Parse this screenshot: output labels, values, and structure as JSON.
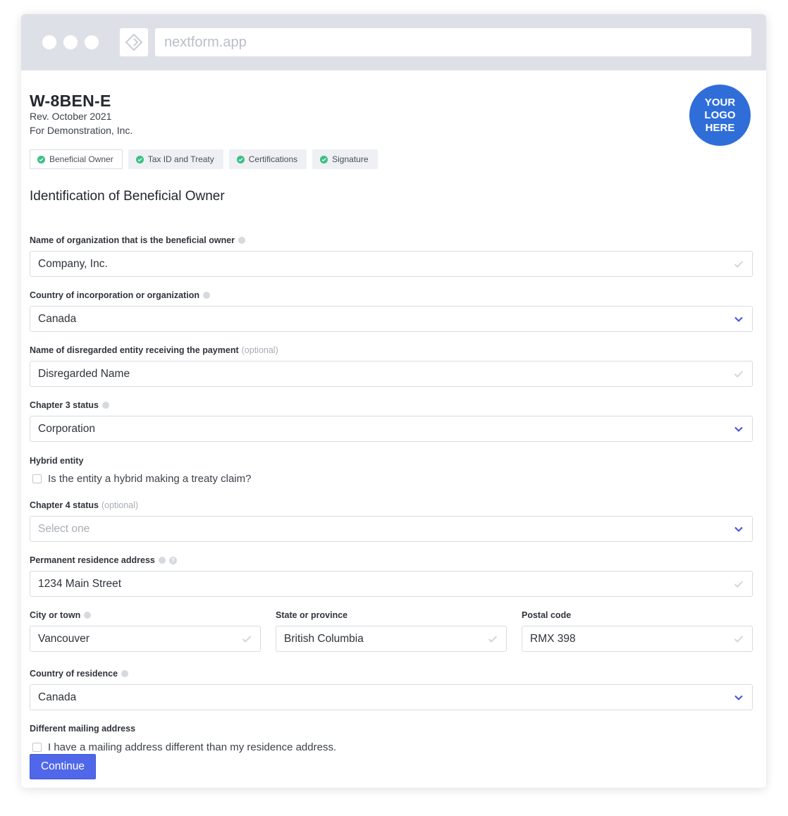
{
  "browser": {
    "url": "nextform.app"
  },
  "header": {
    "form_title": "W-8BEN-E",
    "revision": "Rev. October 2021",
    "for_company": "For Demonstration, Inc.",
    "logo_lines": [
      "YOUR",
      "LOGO",
      "HERE"
    ]
  },
  "steps": [
    {
      "label": "Beneficial Owner",
      "active": true
    },
    {
      "label": "Tax ID and Treaty",
      "active": false
    },
    {
      "label": "Certifications",
      "active": false
    },
    {
      "label": "Signature",
      "active": false
    }
  ],
  "section_title": "Identification of Beneficial Owner",
  "fields": {
    "org_name": {
      "label": "Name of organization that is the beneficial owner",
      "value": "Company, Inc."
    },
    "country_incorp": {
      "label": "Country of incorporation or organization",
      "value": "Canada"
    },
    "disregarded": {
      "label": "Name of disregarded entity receiving the payment",
      "optional": "(optional)",
      "value": "Disregarded Name"
    },
    "chapter3": {
      "label": "Chapter 3 status",
      "value": "Corporation"
    },
    "hybrid": {
      "label": "Hybrid entity",
      "checkbox_label": "Is the entity a hybrid making a treaty claim?",
      "checked": false
    },
    "chapter4": {
      "label": "Chapter 4 status",
      "optional": "(optional)",
      "placeholder": "Select one"
    },
    "address": {
      "label": "Permanent residence address",
      "value": "1234 Main Street"
    },
    "city": {
      "label": "City or town",
      "value": "Vancouver"
    },
    "state": {
      "label": "State or province",
      "value": "British Columbia"
    },
    "postal": {
      "label": "Postal code",
      "value": "RMX 398"
    },
    "country_res": {
      "label": "Country of residence",
      "value": "Canada"
    },
    "mailing": {
      "label": "Different mailing address",
      "checkbox_label": "I have a mailing address different than my residence address.",
      "checked": false
    }
  },
  "continue_label": "Continue",
  "colors": {
    "accent": "#4f67e8",
    "logo": "#2f6ed9",
    "success": "#3bbf86",
    "chevron": "#3f51d6"
  }
}
